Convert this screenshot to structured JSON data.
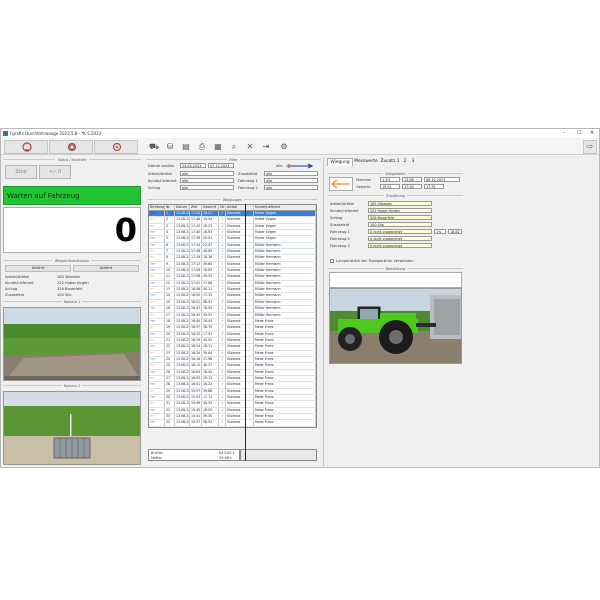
{
  "window": {
    "title": "Fgrafix Durchfahrwaage 2023.5.8 - *K.5.2023",
    "min": "–",
    "max": "☐",
    "close": "✕"
  },
  "toolbar": {
    "left_buttons": [
      {
        "icon": "scale-icon"
      },
      {
        "icon": "camera-icon"
      },
      {
        "icon": "gear-refresh-icon"
      }
    ],
    "tools": [
      {
        "icon": "truck-icon",
        "glyph": "⛟"
      },
      {
        "icon": "database-icon",
        "glyph": "⛁"
      },
      {
        "icon": "document-icon",
        "glyph": "▤"
      },
      {
        "icon": "print-icon",
        "glyph": "⎙"
      },
      {
        "icon": "print-preview-icon",
        "glyph": "▦"
      },
      {
        "icon": "search-document-icon",
        "glyph": "⌕"
      },
      {
        "icon": "delete-icon",
        "glyph": "✕"
      },
      {
        "icon": "export-icon",
        "glyph": "⇥"
      },
      {
        "icon": "settings-icon",
        "glyph": "⚙"
      }
    ],
    "exit_icon": "⇨"
  },
  "left": {
    "status_section": "Status / Kontrolle",
    "stop_label": "Stop",
    "tare_label": "+/- 0",
    "status_text": "Warten auf Fahrzeug",
    "status_color": "#22c436",
    "weight": "0",
    "weight_section": "Wiegeinformationen",
    "tabs": [
      "Anfahrt",
      "Anfahrt"
    ],
    "info": [
      {
        "label": "Artikel/Artikel",
        "value": "1KS Silomais"
      },
      {
        "label": "Kunde/Lieferant",
        "value": "222 Huber Jürgen"
      },
      {
        "label": "Schlag",
        "value": "326 Bauerfeld"
      },
      {
        "label": "Zusatzfeld",
        "value": "100 Silo"
      }
    ],
    "camera1": "Kamera 1",
    "camera2": "Kamera 2"
  },
  "filter": {
    "section": "Filter",
    "datum_label": "Datum von/bis",
    "date_from": "23.03.2023",
    "date_to": "07.12.2023",
    "rows": [
      {
        "label": "Artikel/Artikel",
        "value": "alle"
      },
      {
        "label": "Kunde/Lieferant",
        "value": "alle"
      },
      {
        "label": "Schlag",
        "value": "alle"
      }
    ],
    "rows2": [
      {
        "label": "Zusatzfeld",
        "value": "alle"
      },
      {
        "label": "Fahrzeug 1",
        "value": "alle"
      },
      {
        "label": "Fahrzeug 2",
        "value": "alle"
      }
    ],
    "direction_label": "alle"
  },
  "grid": {
    "section": "Wiegungen",
    "columns": [
      "Richtung",
      "Nr.",
      "Datum",
      "Zeit",
      "Gewicht",
      "Ok",
      "Artikel",
      "Kunde/Lieferant"
    ],
    "rows": [
      {
        "dir": "r",
        "nr": "1",
        "datum": "13.08.23",
        "zeit": "17:50",
        "gew": "19.01",
        "art": "Silomais",
        "kunde": "Huber Jürgen",
        "sel": true
      },
      {
        "dir": "l",
        "nr": "2",
        "datum": "13.08.23",
        "zeit": "17:46",
        "gew": "19.54",
        "art": "Silomais",
        "kunde": "Huber Jürgen"
      },
      {
        "dir": "l",
        "nr": "3",
        "datum": "13.08.23",
        "zeit": "17:43",
        "gew": "18.23",
        "art": "Silomais",
        "kunde": "Huber Jürgen"
      },
      {
        "dir": "r",
        "nr": "4",
        "datum": "13.08.23",
        "zeit": "17:40",
        "gew": "18.93",
        "art": "Silomais",
        "kunde": "Huber Jürgen"
      },
      {
        "dir": "r",
        "nr": "5",
        "datum": "13.08.23",
        "zeit": "17:36",
        "gew": "20.01",
        "art": "Silomais",
        "kunde": "Huber Jürgen"
      },
      {
        "dir": "r",
        "nr": "6",
        "datum": "13.08.23",
        "zeit": "17:32",
        "gew": "23.97",
        "art": "Silomais",
        "kunde": "Müller Hermann"
      },
      {
        "dir": "l",
        "nr": "7",
        "datum": "13.08.23",
        "zeit": "17:26",
        "gew": "40.69",
        "art": "Silomais",
        "kunde": "Müller Hermann"
      },
      {
        "dir": "l",
        "nr": "8",
        "datum": "13.08.23",
        "zeit": "17:19",
        "gew": "18.36",
        "art": "Silomais",
        "kunde": "Müller Hermann"
      },
      {
        "dir": "r",
        "nr": "9",
        "datum": "13.08.23",
        "zeit": "17:12",
        "gew": "39.80",
        "art": "Silomais",
        "kunde": "Müller Hermann"
      },
      {
        "dir": "r",
        "nr": "10",
        "datum": "13.08.23",
        "zeit": "17:09",
        "gew": "18.09",
        "art": "Silomais",
        "kunde": "Müller Hermann"
      },
      {
        "dir": "l",
        "nr": "11",
        "datum": "13.08.23",
        "zeit": "17:06",
        "gew": "39.53",
        "art": "Silomais",
        "kunde": "Müller Hermann"
      },
      {
        "dir": "r",
        "nr": "12",
        "datum": "13.08.23",
        "zeit": "17:02",
        "gew": "17.86",
        "art": "Silomais",
        "kunde": "Müller Hermann"
      },
      {
        "dir": "l",
        "nr": "13",
        "datum": "13.08.23",
        "zeit": "16:58",
        "gew": "40.11",
        "art": "Silomais",
        "kunde": "Müller Hermann"
      },
      {
        "dir": "r",
        "nr": "14",
        "datum": "13.08.23",
        "zeit": "16:55",
        "gew": "17.35",
        "art": "Silomais",
        "kunde": "Müller Hermann"
      },
      {
        "dir": "l",
        "nr": "15",
        "datum": "13.08.23",
        "zeit": "16:51",
        "gew": "36.91",
        "art": "Silomais",
        "kunde": "Müller Hermann"
      },
      {
        "dir": "r",
        "nr": "16",
        "datum": "13.08.23",
        "zeit": "16:47",
        "gew": "18.09",
        "art": "Silomais",
        "kunde": "Müller Hermann"
      },
      {
        "dir": "l",
        "nr": "17",
        "datum": "13.08.23",
        "zeit": "16:43",
        "gew": "39.52",
        "art": "Silomais",
        "kunde": "Müller Hermann"
      },
      {
        "dir": "r",
        "nr": "18",
        "datum": "13.08.23",
        "zeit": "16:40",
        "gew": "18.43",
        "art": "Silomais",
        "kunde": "Meier Franz"
      },
      {
        "dir": "l",
        "nr": "19",
        "datum": "13.08.23",
        "zeit": "16:37",
        "gew": "38.70",
        "art": "Silomais",
        "kunde": "Meier Franz"
      },
      {
        "dir": "r",
        "nr": "20",
        "datum": "13.08.23",
        "zeit": "16:33",
        "gew": "17.91",
        "art": "Silomais",
        "kunde": "Meier Franz"
      },
      {
        "dir": "l",
        "nr": "21",
        "datum": "13.08.23",
        "zeit": "16:29",
        "gew": "40.02",
        "art": "Silomais",
        "kunde": "Meier Franz"
      },
      {
        "dir": "r",
        "nr": "22",
        "datum": "13.08.23",
        "zeit": "16:24",
        "gew": "18.11",
        "art": "Silomais",
        "kunde": "Meier Franz"
      },
      {
        "dir": "l",
        "nr": "23",
        "datum": "13.08.23",
        "zeit": "16:20",
        "gew": "39.64",
        "art": "Silomais",
        "kunde": "Meier Franz"
      },
      {
        "dir": "r",
        "nr": "24",
        "datum": "13.08.23",
        "zeit": "16:16",
        "gew": "17.98",
        "art": "Silomais",
        "kunde": "Meier Franz"
      },
      {
        "dir": "l",
        "nr": "25",
        "datum": "13.08.23",
        "zeit": "16:12",
        "gew": "40.27",
        "art": "Silomais",
        "kunde": "Meier Franz"
      },
      {
        "dir": "r",
        "nr": "26",
        "datum": "13.08.23",
        "zeit": "16:09",
        "gew": "18.40",
        "art": "Silomais",
        "kunde": "Meier Franz"
      },
      {
        "dir": "l",
        "nr": "27",
        "datum": "13.08.23",
        "zeit": "16:05",
        "gew": "39.12",
        "art": "Silomais",
        "kunde": "Meier Franz"
      },
      {
        "dir": "r",
        "nr": "28",
        "datum": "13.08.23",
        "zeit": "16:01",
        "gew": "18.22",
        "art": "Silomais",
        "kunde": "Meier Franz"
      },
      {
        "dir": "l",
        "nr": "29",
        "datum": "13.08.23",
        "zeit": "15:57",
        "gew": "39.88",
        "art": "Silomais",
        "kunde": "Meier Franz"
      },
      {
        "dir": "r",
        "nr": "30",
        "datum": "13.08.23",
        "zeit": "15:53",
        "gew": "17.74",
        "art": "Silomais",
        "kunde": "Meier Franz"
      },
      {
        "dir": "l",
        "nr": "31",
        "datum": "13.08.23",
        "zeit": "15:49",
        "gew": "40.53",
        "art": "Silomais",
        "kunde": "Meier Franz"
      },
      {
        "dir": "r",
        "nr": "32",
        "datum": "13.08.23",
        "zeit": "15:45",
        "gew": "18.05",
        "art": "Silomais",
        "kunde": "Meier Franz"
      },
      {
        "dir": "l",
        "nr": "33",
        "datum": "13.08.23",
        "zeit": "15:41",
        "gew": "39.30",
        "art": "Silomais",
        "kunde": "Meier Franz"
      },
      {
        "dir": "r",
        "nr": "34",
        "datum": "13.08.23",
        "zeit": "15:37",
        "gew": "38.52",
        "art": "Silomais",
        "kunde": "Meier Franz"
      }
    ],
    "footer": [
      {
        "label": "Brutto:",
        "value": "843.00 t"
      },
      {
        "label": "Netto:",
        "value": "29.06 t"
      }
    ]
  },
  "right": {
    "tabs": [
      "Wiegung",
      "Messwerte",
      "Zusatz 1",
      "2",
      "3"
    ],
    "wiege_section": "Wiegedaten",
    "nummer_label": "Nummer",
    "gewicht_label": "Gewicht",
    "nummer": "1.3/1",
    "datum": "13.08.",
    "zeit": "17:50",
    "date2": "06.10.2023",
    "gewicht": "19.01",
    "status": "17:51",
    "zuordnung_section": "Zuordnung",
    "fields": [
      {
        "label": "Artikel/Artikel",
        "value": "1KS Silomais"
      },
      {
        "label": "Kunde/Lieferant",
        "value": "222 Huber Jürgen"
      },
      {
        "label": "Schlag",
        "value": "326 Bauerfeld"
      },
      {
        "label": "Zusatzfeld",
        "value": "100 Silo"
      },
      {
        "label": "Fahrzeug 1",
        "value": "0 nicht zugeordnet"
      },
      {
        "label": "Fahrzeug 2",
        "value": "0 nicht zugeordnet"
      },
      {
        "label": "Fahrzeug 3",
        "value": "0 nicht zugeordnet"
      }
    ],
    "extra_values": [
      "1%",
      "18.82"
    ],
    "checkbox_label": "Lumpenstück der Transportfuhr verwenden",
    "bemerkung_section": "Bemerkung",
    "bilder_section": "Bilder"
  },
  "colors": {
    "accent": "#3b7fd9",
    "status_green": "#22c436",
    "arrow_right": "#1f2f9e",
    "arrow_left": "#f08a2a"
  }
}
